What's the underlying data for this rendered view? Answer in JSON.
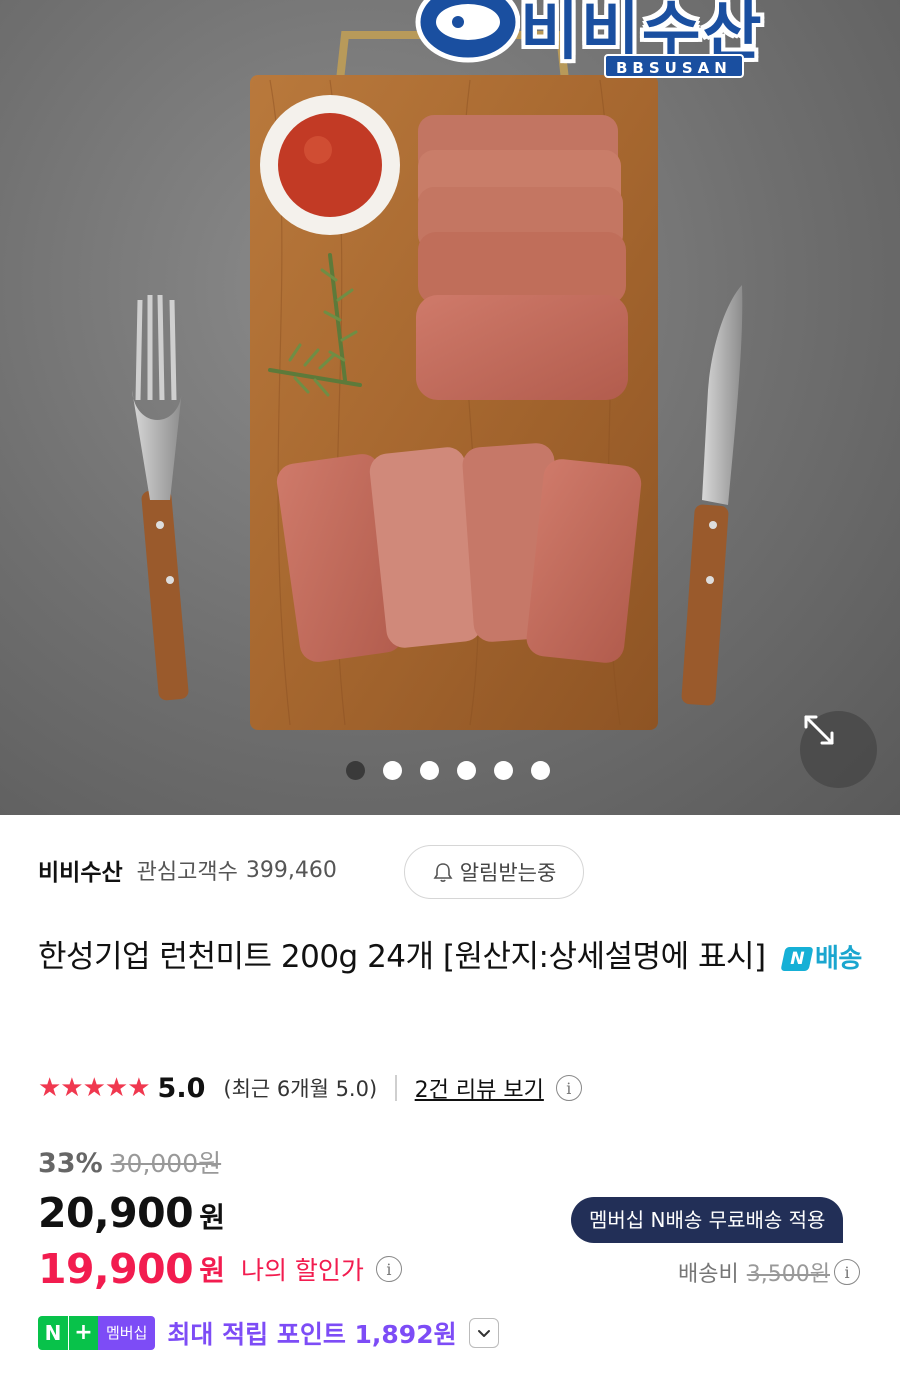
{
  "brand": {
    "logo_text": "비비수산",
    "logo_sub": "BBSUSAN"
  },
  "gallery": {
    "dot_count": 6,
    "active_index": 0
  },
  "seller": {
    "name": "비비수산",
    "fans_label": "관심고객수",
    "fans_count": "399,460",
    "alarm_label": "알림받는중"
  },
  "product": {
    "title": "한성기업 런천미트 200g 24개 [원산지:상세설명에 표시]",
    "n_delivery_badge": "N",
    "n_delivery_label": "배송"
  },
  "rating": {
    "stars": "★★★★★",
    "score": "5.0",
    "recent": "(최근 6개월 5.0)",
    "review_link": "2건 리뷰 보기",
    "info_glyph": "i"
  },
  "pricing": {
    "discount_percent": "33%",
    "original_price": "30,000원",
    "price": "20,900",
    "currency": "원",
    "member_price": "19,900",
    "member_currency": "원",
    "my_discount_label": "나의 할인가",
    "tooltip": "멤버십 N배송 무료배송 적용",
    "shipping_label": "배송비",
    "shipping_fee": "3,500원"
  },
  "points": {
    "badge_n": "N",
    "badge_plus": "+",
    "badge_member": "멤버십",
    "text": "최대 적립 포인트 1,892원"
  },
  "colors": {
    "accent_red": "#f21c4f",
    "star_red": "#f0384f",
    "purple": "#7d4cf6",
    "green": "#08c24a",
    "navy": "#222f57",
    "brand_blue": "#1a4fa0"
  }
}
